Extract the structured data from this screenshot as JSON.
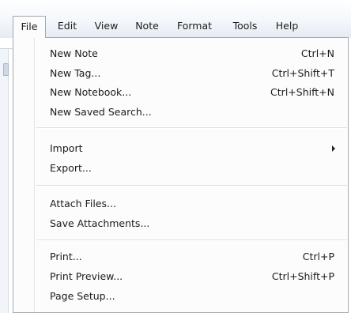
{
  "menubar": {
    "items": [
      {
        "label": "File"
      },
      {
        "label": "Edit"
      },
      {
        "label": "View"
      },
      {
        "label": "Note"
      },
      {
        "label": "Format"
      },
      {
        "label": "Tools"
      },
      {
        "label": "Help"
      }
    ]
  },
  "file_menu": {
    "items": [
      {
        "label": "New Note",
        "shortcut": "Ctrl+N"
      },
      {
        "label": "New Tag...",
        "shortcut": "Ctrl+Shift+T"
      },
      {
        "label": "New Notebook...",
        "shortcut": "Ctrl+Shift+N"
      },
      {
        "label": "New Saved Search...",
        "shortcut": ""
      },
      {
        "label": "Import",
        "shortcut": ""
      },
      {
        "label": "Export...",
        "shortcut": ""
      },
      {
        "label": "Attach Files...",
        "shortcut": ""
      },
      {
        "label": "Save Attachments...",
        "shortcut": ""
      },
      {
        "label": "Print...",
        "shortcut": "Ctrl+P"
      },
      {
        "label": "Print Preview...",
        "shortcut": "Ctrl+Shift+P"
      },
      {
        "label": "Page Setup...",
        "shortcut": ""
      }
    ]
  },
  "colors": {
    "menu_border": "#a0aab6",
    "menu_background": "#fcfcfd",
    "menubar_gradient_end": "#e5ebf3"
  }
}
